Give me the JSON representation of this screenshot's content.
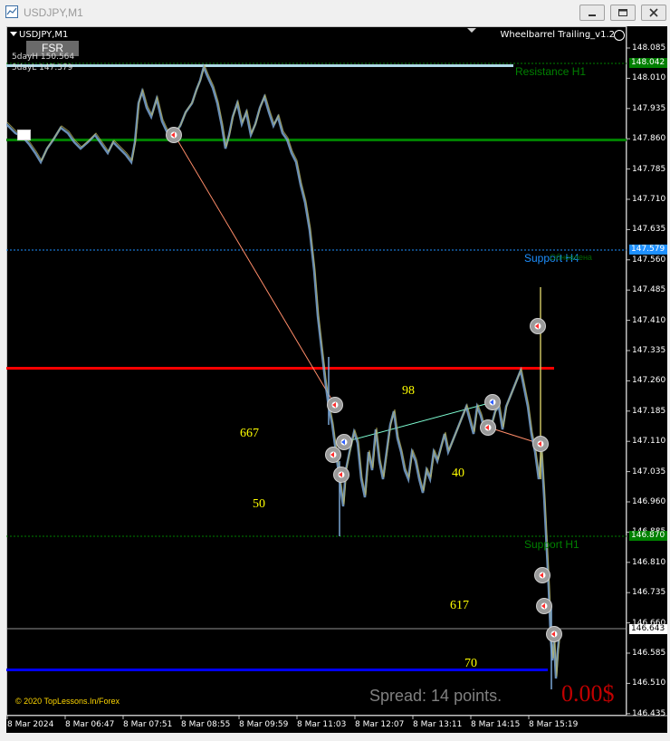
{
  "window": {
    "title": "USDJPY,M1"
  },
  "chart": {
    "symbol_label": "USDJPY,M1",
    "fsr_label": "FSR",
    "info_high": "5dayH 150.564",
    "info_low": "5dayL 147.379",
    "indicator": "Wheelbarrel Trailing_v1.2",
    "resistance_label": "Resistance H1",
    "support_h4_label": "Support H4",
    "support_h1_label": "Support H1",
    "support_h1_overlay": "Обновлена",
    "spread": "Spread: 14 points.",
    "profit": "0.00$",
    "copyright": "© 2020 TopLessons.In/Forex",
    "yellow_numbers": [
      {
        "text": "98"
      },
      {
        "text": "667"
      },
      {
        "text": "40"
      },
      {
        "text": "50"
      },
      {
        "text": "617"
      },
      {
        "text": "70"
      }
    ],
    "price_axis": [
      "148.085",
      "148.010",
      "147.935",
      "147.860",
      "147.785",
      "147.710",
      "147.635",
      "147.560",
      "147.485",
      "147.410",
      "147.335",
      "147.260",
      "147.185",
      "147.110",
      "147.035",
      "146.960",
      "146.885",
      "146.810",
      "146.735",
      "146.660",
      "146.585",
      "146.510",
      "146.435"
    ],
    "price_tags": {
      "resistance": {
        "text": "148.042",
        "color": "#008000"
      },
      "support_h4": {
        "text": "147.579",
        "color": "#1e90ff"
      },
      "support_h1": {
        "text": "146.870",
        "color": "#008000"
      },
      "current": {
        "text": "146.643",
        "color": "#ffffff"
      }
    },
    "time_axis": [
      "8 Mar 2024",
      "8 Mar 06:47",
      "8 Mar 07:51",
      "8 Mar 08:55",
      "8 Mar 09:59",
      "8 Mar 11:03",
      "8 Mar 12:07",
      "8 Mar 13:11",
      "8 Mar 14:15",
      "8 Mar 15:19"
    ],
    "colors": {
      "background": "#000000",
      "candles": "#7ba7d6",
      "candles_alt": "#c8c060",
      "green_line": "#008000",
      "red_line": "#ff0000",
      "blue_line": "#0000ff",
      "light_line": "#add8e6",
      "yellow": "#ffff00"
    }
  }
}
